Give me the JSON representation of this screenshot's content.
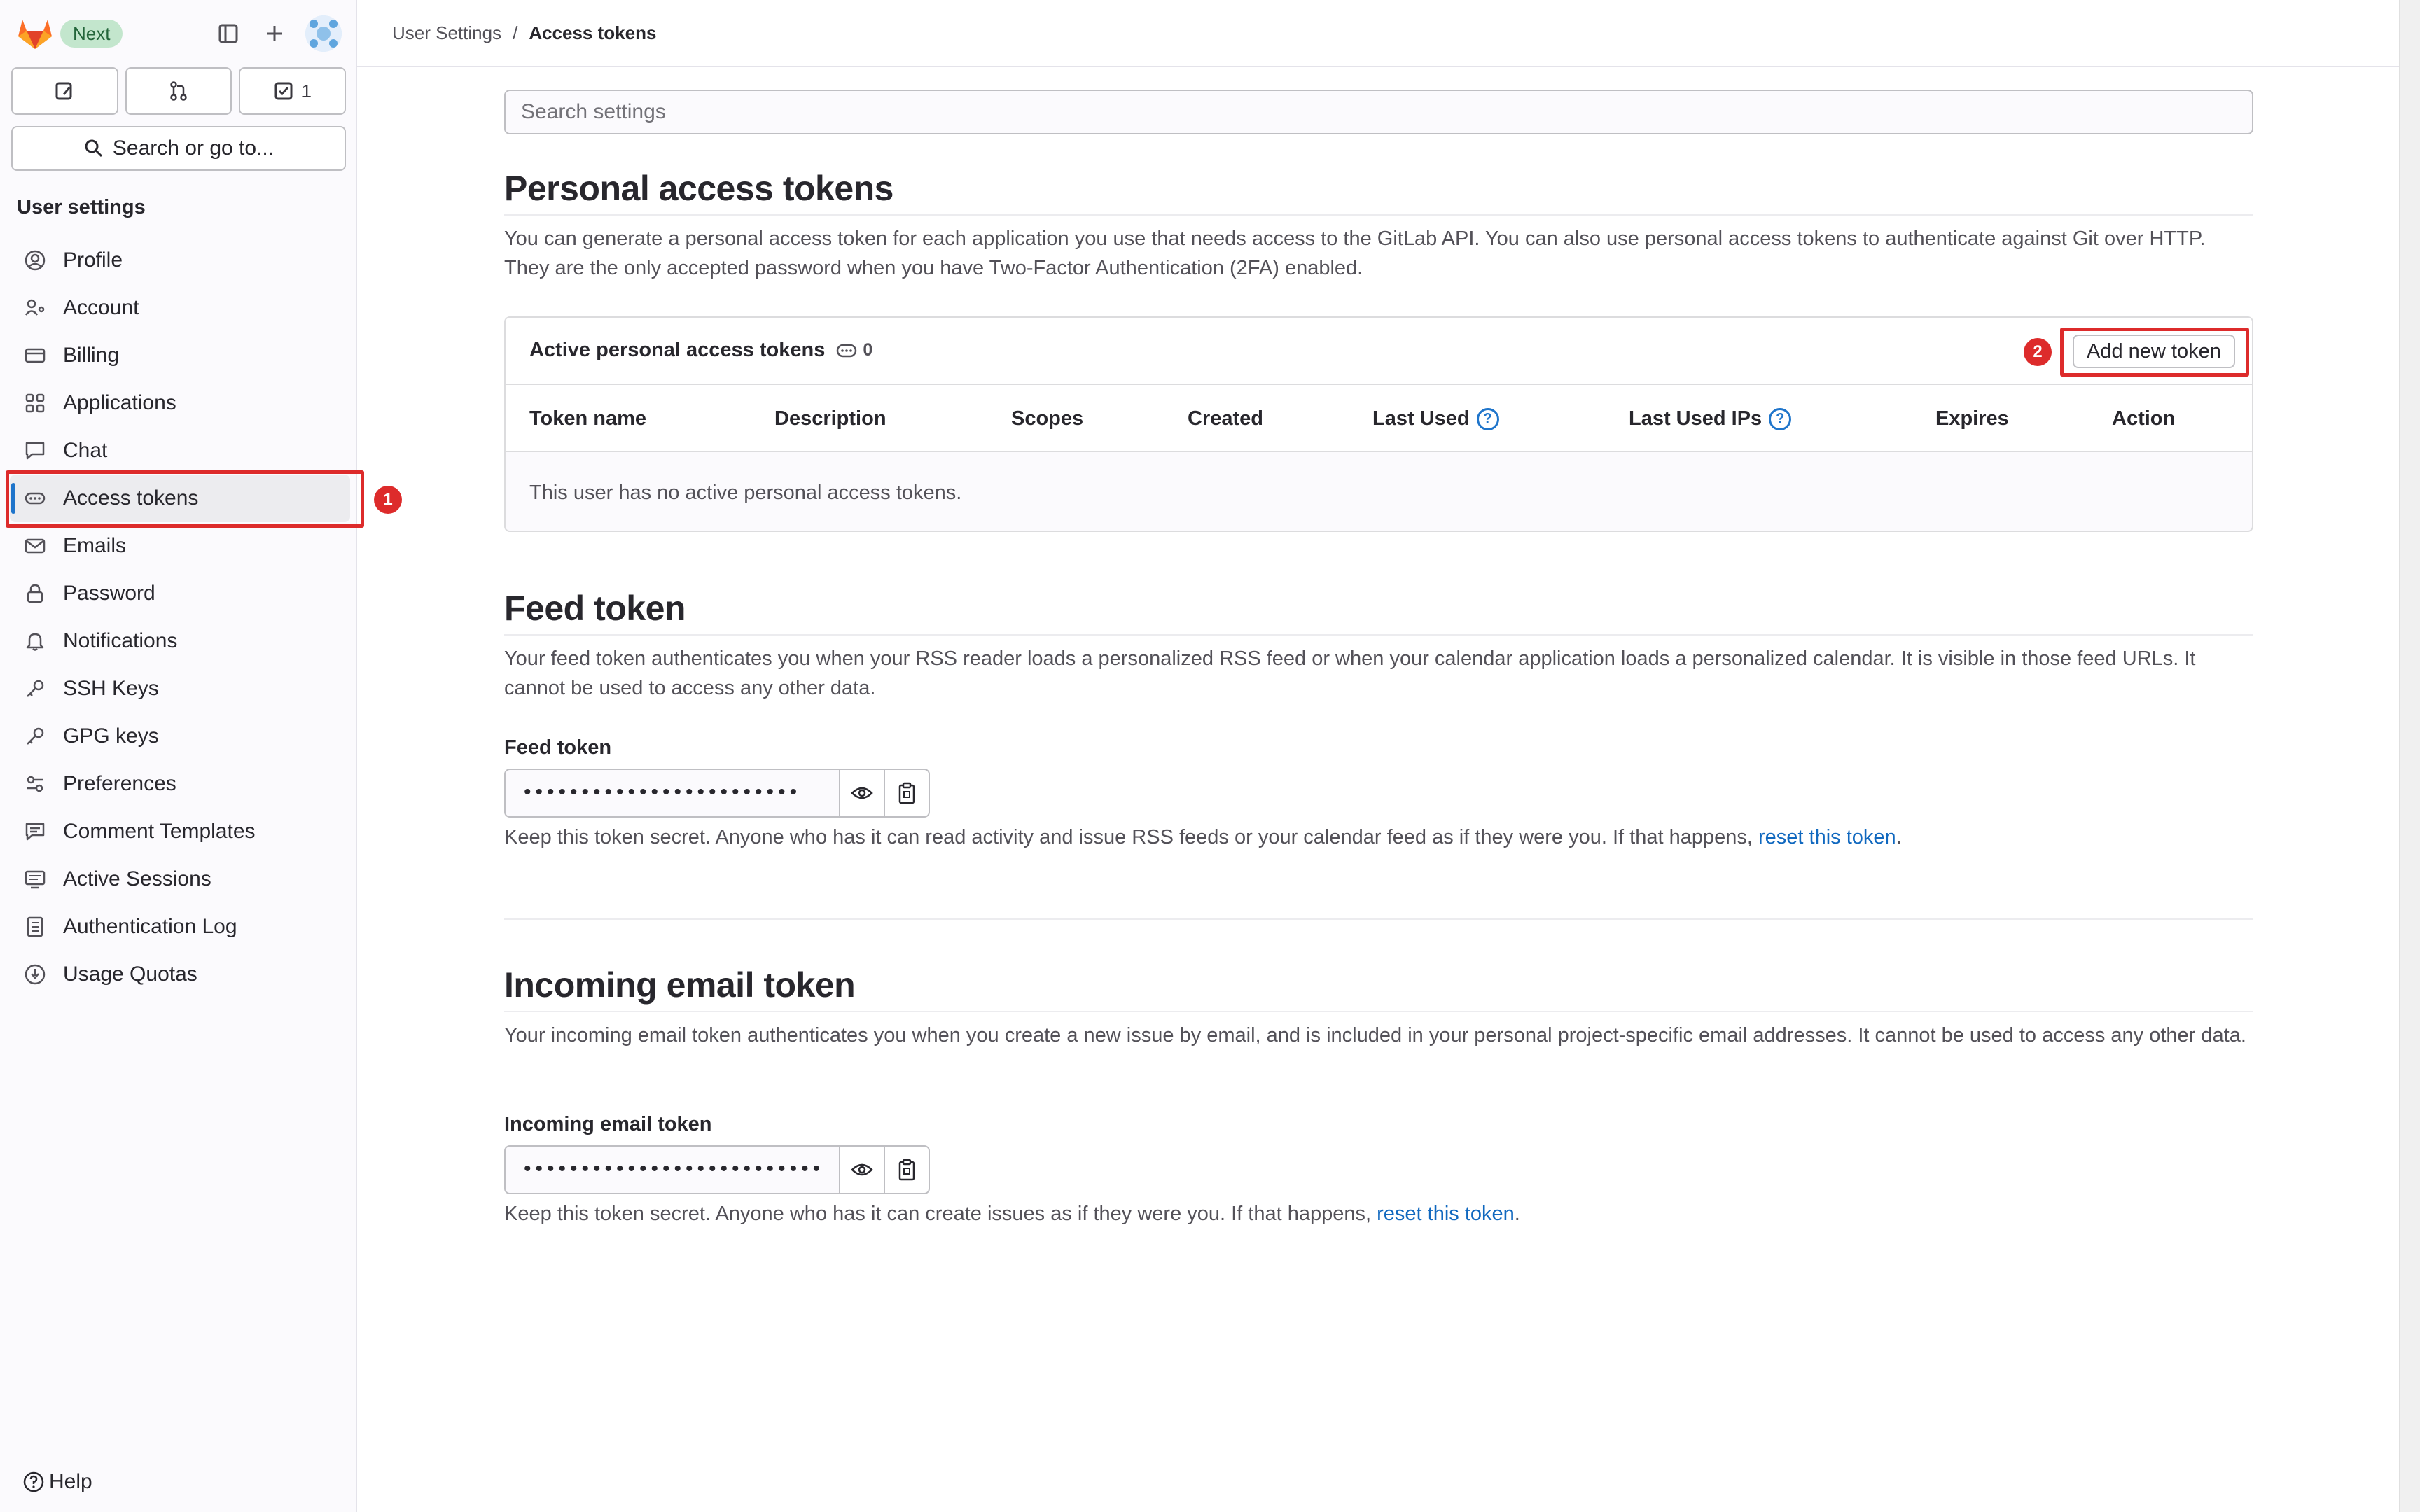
{
  "sidebar": {
    "next_badge": "Next",
    "tabs": [
      {
        "icon": "issues-icon",
        "count": ""
      },
      {
        "icon": "merge-request-icon",
        "count": ""
      },
      {
        "icon": "todo-icon",
        "count": "1"
      }
    ],
    "search_label": "Search or go to...",
    "heading": "User settings",
    "items": [
      {
        "label": "Profile",
        "icon": "profile-icon"
      },
      {
        "label": "Account",
        "icon": "account-icon"
      },
      {
        "label": "Billing",
        "icon": "billing-icon"
      },
      {
        "label": "Applications",
        "icon": "applications-icon"
      },
      {
        "label": "Chat",
        "icon": "chat-icon"
      },
      {
        "label": "Access tokens",
        "icon": "token-icon",
        "active": true
      },
      {
        "label": "Emails",
        "icon": "mail-icon"
      },
      {
        "label": "Password",
        "icon": "lock-icon"
      },
      {
        "label": "Notifications",
        "icon": "bell-icon"
      },
      {
        "label": "SSH Keys",
        "icon": "key-icon"
      },
      {
        "label": "GPG keys",
        "icon": "key-icon"
      },
      {
        "label": "Preferences",
        "icon": "preferences-icon"
      },
      {
        "label": "Comment Templates",
        "icon": "comment-icon"
      },
      {
        "label": "Active Sessions",
        "icon": "monitor-icon"
      },
      {
        "label": "Authentication Log",
        "icon": "log-icon"
      },
      {
        "label": "Usage Quotas",
        "icon": "quota-icon"
      }
    ],
    "help_label": "Help"
  },
  "annotations": {
    "marker_1": "1",
    "marker_2": "2",
    "color": "#dd2b2b"
  },
  "breadcrumb": {
    "parent": "User Settings",
    "separator": "/",
    "current": "Access tokens"
  },
  "main": {
    "search_placeholder": "Search settings",
    "pat": {
      "title": "Personal access tokens",
      "description": "You can generate a personal access token for each application you use that needs access to the GitLab API. You can also use personal access tokens to authenticate against Git over HTTP. They are the only accepted password when you have Two-Factor Authentication (2FA) enabled.",
      "card_title": "Active personal access tokens",
      "count": "0",
      "add_button": "Add new token",
      "columns": [
        "Token name",
        "Description",
        "Scopes",
        "Created",
        "Last Used",
        "Last Used IPs",
        "Expires",
        "Action"
      ],
      "empty_text": "This user has no active personal access tokens."
    },
    "feed": {
      "title": "Feed token",
      "description": "Your feed token authenticates you when your RSS reader loads a personalized RSS feed or when your calendar application loads a personalized calendar. It is visible in those feed URLs. It cannot be used to access any other data.",
      "label": "Feed token",
      "masked_value": "••••••••••••••••••••••••",
      "help_prefix": "Keep this token secret. Anyone who has it can read activity and issue RSS feeds or your calendar feed as if they were you. If that happens, ",
      "reset_link": "reset this token",
      "help_suffix": "."
    },
    "incoming": {
      "title": "Incoming email token",
      "description": "Your incoming email token authenticates you when you create a new issue by email, and is included in your personal project-specific email addresses. It cannot be used to access any other data.",
      "label": "Incoming email token",
      "masked_value": "••••••••••••••••••••••••••",
      "help_prefix": "Keep this token secret. Anyone who has it can create issues as if they were you. If that happens, ",
      "reset_link": "reset this token",
      "help_suffix": "."
    }
  }
}
